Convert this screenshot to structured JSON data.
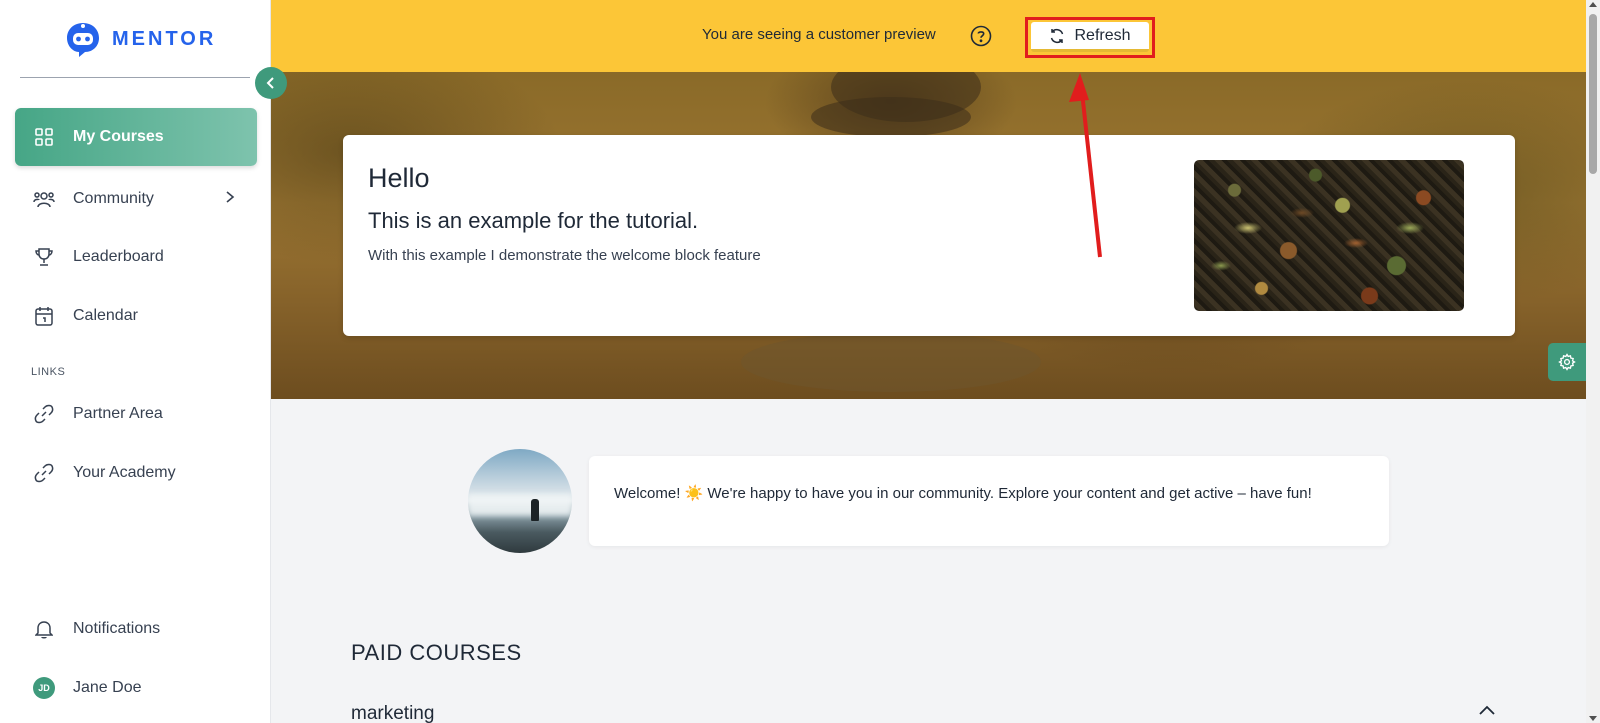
{
  "app": {
    "brand": "MENTOR"
  },
  "sidebar": {
    "items": [
      {
        "label": "My Courses",
        "icon": "grid-icon",
        "active": true
      },
      {
        "label": "Community",
        "icon": "users-icon",
        "has_submenu": true
      },
      {
        "label": "Leaderboard",
        "icon": "trophy-icon"
      },
      {
        "label": "Calendar",
        "icon": "calendar-icon"
      }
    ],
    "links_section_label": "LINKS",
    "links": [
      {
        "label": "Partner Area",
        "icon": "link-icon"
      },
      {
        "label": "Your Academy",
        "icon": "link-icon"
      }
    ],
    "notifications_label": "Notifications",
    "user": {
      "initials": "JD",
      "name": "Jane Doe"
    }
  },
  "preview_bar": {
    "message": "You are seeing a customer preview",
    "refresh_label": "Refresh"
  },
  "welcome_block": {
    "title": "Hello",
    "subtitle": "This is an example for the tutorial.",
    "description": "With this example I demonstrate the welcome block feature"
  },
  "community_message": {
    "text": "Welcome! ☀️ We're happy to have you in our community. Explore your content and get active – have fun!"
  },
  "courses": {
    "section_title": "PAID COURSES",
    "categories": [
      {
        "name": "marketing",
        "expanded": true
      }
    ]
  },
  "colors": {
    "accent": "#3f9a7c",
    "brand": "#2563eb",
    "preview_bar": "#fcc637",
    "annotation": "#e11d1d"
  }
}
